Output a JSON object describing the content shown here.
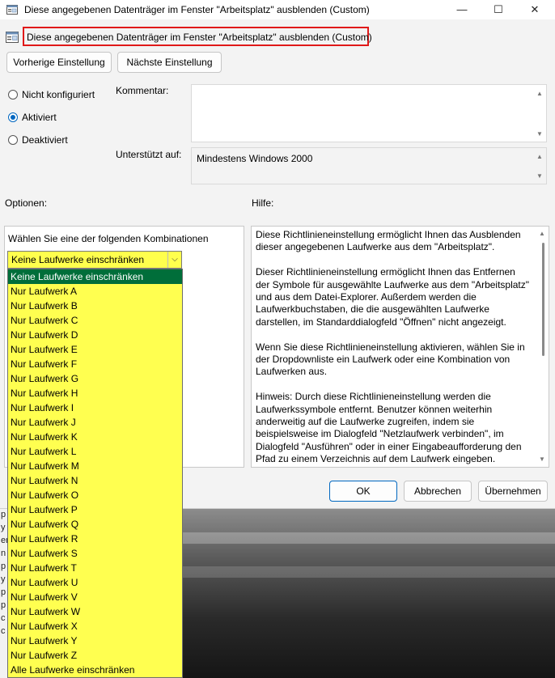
{
  "window": {
    "title": "Diese angegebenen Datenträger im Fenster \"Arbeitsplatz\" ausblenden (Custom)",
    "minimize": "—",
    "maximize": "☐",
    "close": "✕"
  },
  "policy_title": "Diese angegebenen Datenträger im Fenster \"Arbeitsplatz\" ausblenden (Custom)",
  "nav": {
    "previous": "Vorherige Einstellung",
    "next": "Nächste Einstellung"
  },
  "state": {
    "options": [
      "Nicht konfiguriert",
      "Aktiviert",
      "Deaktiviert"
    ],
    "selected": "Aktiviert"
  },
  "comment": {
    "label": "Kommentar:",
    "value": ""
  },
  "supported": {
    "label": "Unterstützt auf:",
    "value": "Mindestens Windows 2000"
  },
  "options_section": {
    "label": "Optionen:",
    "prompt": "Wählen Sie eine der folgenden Kombinationen",
    "combo_value": "Keine Laufwerke einschränken",
    "items": [
      "Keine Laufwerke einschränken",
      "Nur Laufwerk A",
      "Nur Laufwerk B",
      "Nur Laufwerk C",
      "Nur Laufwerk D",
      "Nur Laufwerk E",
      "Nur Laufwerk F",
      "Nur Laufwerk G",
      "Nur Laufwerk H",
      "Nur Laufwerk I",
      "Nur Laufwerk J",
      "Nur Laufwerk K",
      "Nur Laufwerk L",
      "Nur Laufwerk M",
      "Nur Laufwerk N",
      "Nur Laufwerk O",
      "Nur Laufwerk P",
      "Nur Laufwerk Q",
      "Nur Laufwerk R",
      "Nur Laufwerk S",
      "Nur Laufwerk T",
      "Nur Laufwerk U",
      "Nur Laufwerk V",
      "Nur Laufwerk W",
      "Nur Laufwerk X",
      "Nur Laufwerk Y",
      "Nur Laufwerk Z",
      "Alle Laufwerke einschränken"
    ]
  },
  "help": {
    "label": "Hilfe:",
    "paragraphs": [
      "Diese Richtlinieneinstellung ermöglicht Ihnen das Ausblenden dieser angegebenen Laufwerke aus dem \"Arbeitsplatz\".",
      "Dieser Richtlinieneinstellung ermöglicht Ihnen das Entfernen der Symbole für ausgewählte Laufwerke aus dem \"Arbeitsplatz\" und aus dem Datei-Explorer. Außerdem werden die Laufwerkbuchstaben, die die ausgewählten Laufwerke darstellen, im Standarddialogfeld \"Öffnen\" nicht angezeigt.",
      "Wenn Sie diese Richtlinieneinstellung aktivieren, wählen Sie in der Dropdownliste ein Laufwerk oder eine Kombination von Laufwerken aus.",
      "Hinweis: Durch diese Richtlinieneinstellung werden die Laufwerkssymbole entfernt. Benutzer können weiterhin anderweitig auf die Laufwerke zugreifen, indem sie beispielsweise im Dialogfeld \"Netzlaufwerk verbinden\", im Dialogfeld \"Ausführen\" oder in einer Eingabeaufforderung den Pfad zu einem Verzeichnis auf dem Laufwerk eingeben."
    ]
  },
  "buttons": {
    "ok": "OK",
    "cancel": "Abbrechen",
    "apply": "Übernehmen"
  },
  "background_fragments": [
    "p",
    "y",
    "erl",
    "n",
    "p",
    "y",
    "p",
    "p",
    "c",
    "c"
  ],
  "colors": {
    "accent": "#0067c0",
    "highlight_yellow": "#ffff50",
    "selected_item": "#006e3a",
    "title_border": "#e01919"
  },
  "icons": [
    "policy-icon",
    "scroll-up-icon",
    "scroll-down-icon",
    "chevron-down-icon"
  ]
}
